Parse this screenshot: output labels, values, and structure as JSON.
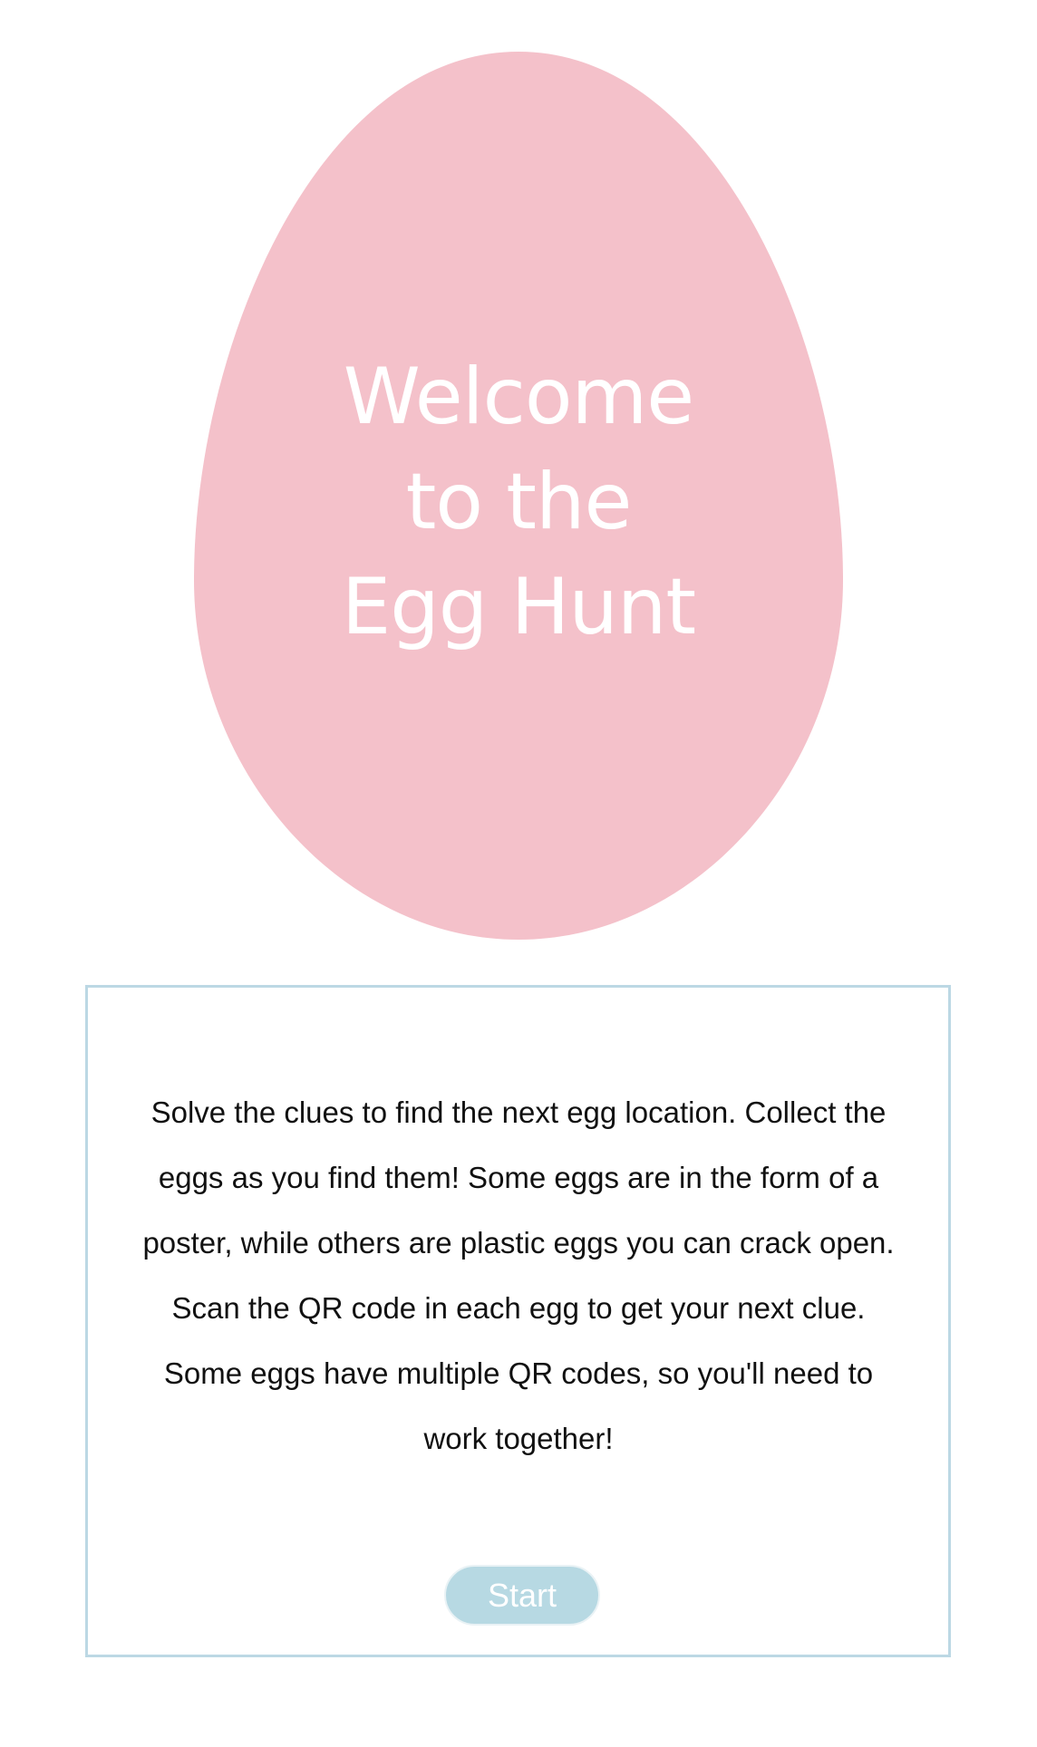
{
  "colors": {
    "egg_fill": "#f4c1ca",
    "egg_text": "#ffffff",
    "box_border": "#bcd8e4",
    "button_fill": "#b7d9e3",
    "button_text": "#ffffff",
    "body_text": "#111111"
  },
  "hero": {
    "title_line_1": "Welcome",
    "title_line_2": "to the",
    "title_line_3": "Egg Hunt"
  },
  "info": {
    "text": "Solve the clues to find the next egg location. Collect the eggs as you find them! Some eggs are in the form of a poster, while others are plastic eggs you can crack open. Scan the QR code in each egg to get your next clue. Some eggs have multiple QR codes, so you'll need to work together!",
    "start_label": "Start"
  }
}
